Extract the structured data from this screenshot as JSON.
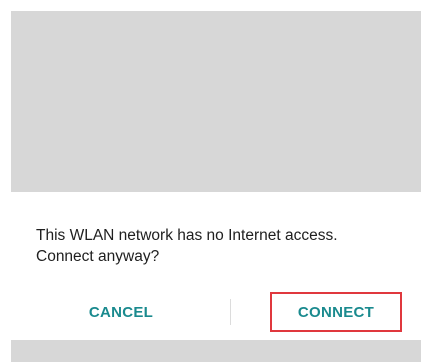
{
  "dialog": {
    "message_line1": "This WLAN network has no Internet access.",
    "message_line2": "Connect anyway?",
    "cancel_label": "CANCEL",
    "connect_label": "CONNECT"
  },
  "colors": {
    "accent": "#1a8a8e",
    "highlight_border": "#e0383e",
    "scrim": "#d7d7d7"
  }
}
